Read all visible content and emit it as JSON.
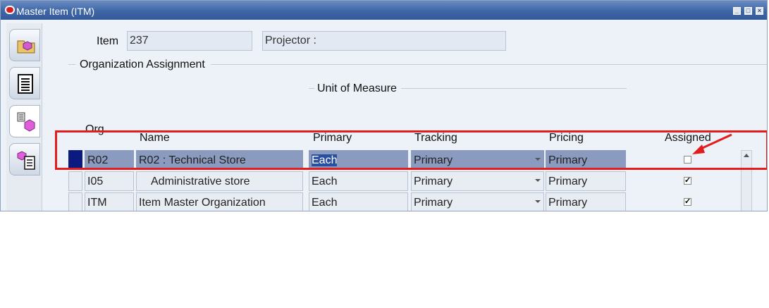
{
  "window": {
    "title": "Master Item (ITM)"
  },
  "header": {
    "item_label": "Item",
    "item_value": "237",
    "description_value": "Projector :"
  },
  "sections": {
    "org_assignment": "Organization Assignment",
    "unit_of_measure": "Unit of Measure"
  },
  "table": {
    "columns": {
      "org": "Org",
      "name": "Name",
      "primary": "Primary",
      "tracking": "Tracking",
      "pricing": "Pricing",
      "assigned": "Assigned"
    },
    "rows": [
      {
        "org": "R02",
        "name": "R02       : Technical Store",
        "primary": "Each",
        "tracking": "Primary",
        "pricing": "Primary",
        "assigned": false,
        "selected": true
      },
      {
        "org": "I05",
        "name": "Administrative store",
        "primary": "Each",
        "tracking": "Primary",
        "pricing": "Primary",
        "assigned": true,
        "selected": false
      },
      {
        "org": "ITM",
        "name": "Item Master Organization",
        "primary": "Each",
        "tracking": "Primary",
        "pricing": "Primary",
        "assigned": true,
        "selected": false
      }
    ]
  },
  "colors": {
    "title_bar": "#3e66a6",
    "highlight": "#e21d1d",
    "selected_row": "#8a9bbf",
    "row_indicator": "#0a1a80"
  },
  "icons": [
    "oracle-icon",
    "minimize-icon",
    "restore-icon",
    "close-icon",
    "folder-cube-icon",
    "list-icon",
    "org-cubes-icon",
    "cube-list-icon",
    "checkbox-icon",
    "dropdown-icon",
    "red-arrow-icon",
    "scroll-up-icon"
  ]
}
